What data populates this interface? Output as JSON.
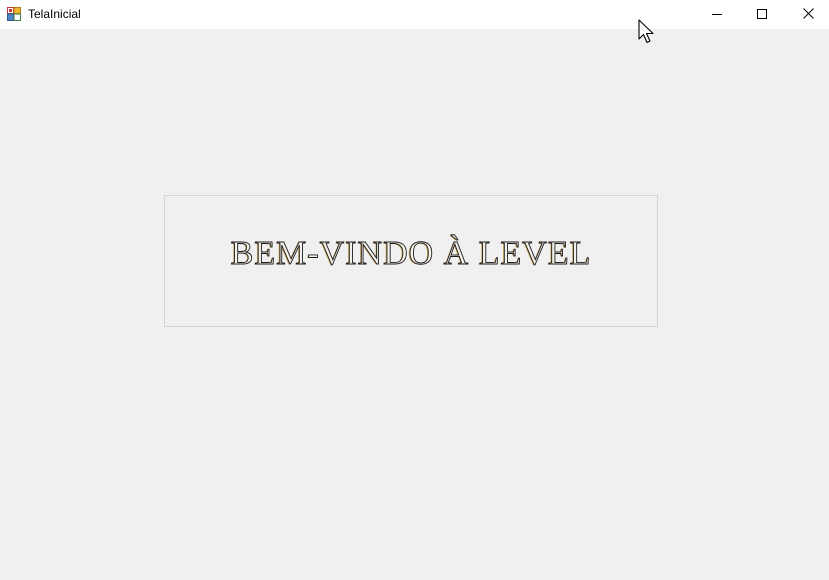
{
  "window": {
    "title": "TelaInicial",
    "icon": "winforms-app-icon",
    "controls": {
      "minimize": "minimize-icon",
      "maximize": "maximize-icon",
      "close": "close-icon"
    }
  },
  "main": {
    "welcome_text": "BEM-VINDO À LEVEL"
  },
  "colors": {
    "background": "#f0f0f0",
    "titlebar": "#ffffff",
    "panel_border": "#d4d4d4",
    "text_outline": "#1b1b1b",
    "text_shadow": "#c9a45c"
  }
}
